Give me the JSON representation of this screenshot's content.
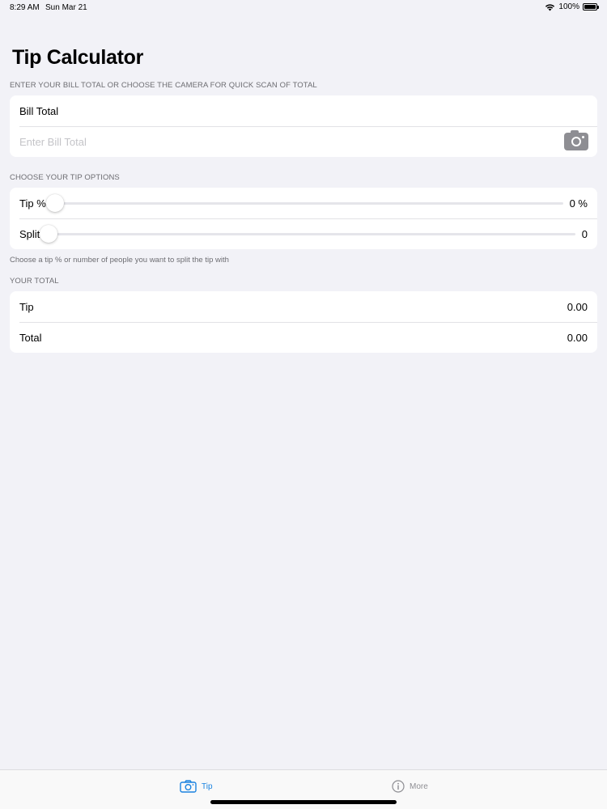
{
  "status_bar": {
    "time": "8:29 AM",
    "date": "Sun Mar 21",
    "battery": "100%"
  },
  "title": "Tip Calculator",
  "bill_section": {
    "header": "ENTER YOUR BILL TOTAL OR CHOOSE THE CAMERA FOR QUICK SCAN OF TOTAL",
    "label": "Bill Total",
    "placeholder": "Enter Bill Total",
    "camera_icon": "camera-icon"
  },
  "tip_options": {
    "header": "CHOOSE YOUR TIP OPTIONS",
    "tip_label": "Tip %",
    "tip_value_text": "0 %",
    "tip_value": 0,
    "split_label": "Split",
    "split_value_text": "0",
    "split_value": 0,
    "footer": "Choose a tip % or number of people you want to split the tip with"
  },
  "total_section": {
    "header": "YOUR TOTAL",
    "tip_label": "Tip",
    "tip_amount": "0.00",
    "total_label": "Total",
    "total_amount": "0.00"
  },
  "tab_bar": {
    "tabs": [
      {
        "label": "Tip",
        "icon": "camera-icon",
        "active": true
      },
      {
        "label": "More",
        "icon": "info-icon",
        "active": false
      }
    ]
  },
  "colors": {
    "accent": "#1a83e0",
    "background": "#f2f2f7",
    "secondary_text": "#6d6d72"
  }
}
